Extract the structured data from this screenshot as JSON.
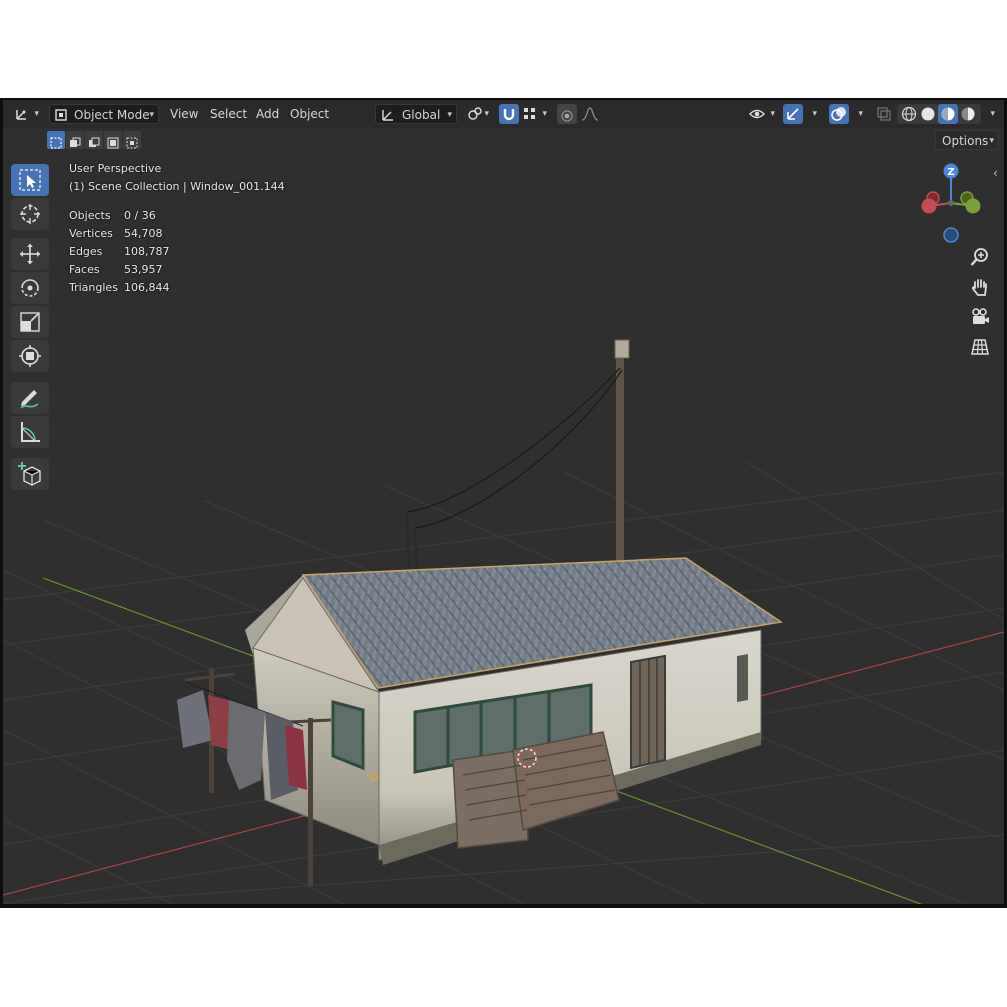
{
  "header": {
    "mode_label": "Object Mode",
    "menus": [
      "View",
      "Select",
      "Add",
      "Object"
    ],
    "transform_orientation": "Global",
    "options_label": "Options"
  },
  "viewport": {
    "view_name": "User Perspective",
    "collection_info": "(1) Scene Collection | Window_001.144"
  },
  "stats": [
    {
      "label": "Objects",
      "value": "0 / 36"
    },
    {
      "label": "Vertices",
      "value": "54,708"
    },
    {
      "label": "Edges",
      "value": "108,787"
    },
    {
      "label": "Faces",
      "value": "53,957"
    },
    {
      "label": "Triangles",
      "value": "106,844"
    }
  ],
  "gizmo": {
    "z_label": "Z"
  },
  "icons": {
    "tools": [
      "select-box-icon",
      "cursor-icon",
      "move-icon",
      "rotate-icon",
      "scale-icon",
      "transform-icon",
      "annotate-icon",
      "measure-icon",
      "add-cube-icon"
    ],
    "nav": [
      "zoom-icon",
      "pan-hand-icon",
      "camera-icon",
      "grid-view-icon"
    ]
  },
  "colors": {
    "accent": "#4772b3",
    "x_axis": "#c44a55",
    "y_axis": "#7da03a",
    "z_axis": "#4f86d8",
    "grid": "#3c3c3c",
    "background": "#2f2f2f"
  }
}
